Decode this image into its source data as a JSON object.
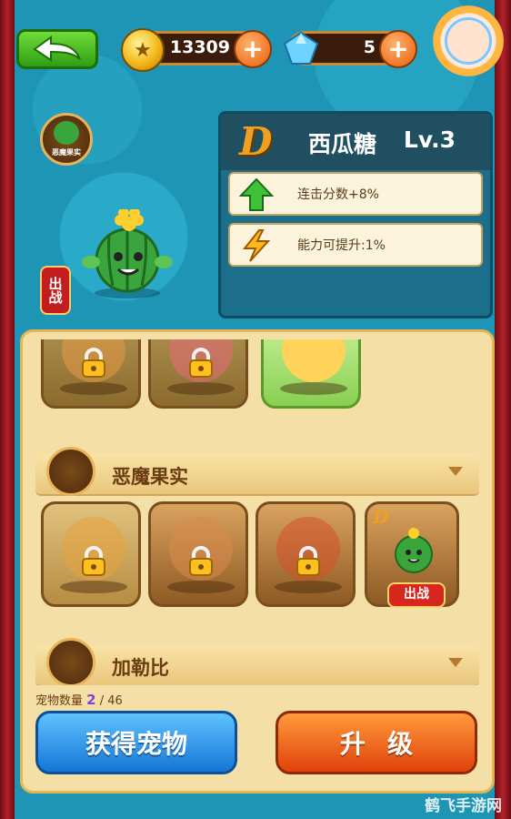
{
  "resources": {
    "coins": "13309",
    "gems": "5"
  },
  "pet": {
    "category_badge": "恶魔果实",
    "battle_tag": "出战",
    "grade": "D",
    "name": "西瓜糖",
    "level": "Lv.3",
    "stats": [
      {
        "text": "连击分数+8%",
        "icon": "green-arrow-up-icon"
      },
      {
        "text": "能力可提升:1%",
        "icon": "lightning-icon"
      }
    ]
  },
  "categories": [
    {
      "name": "恶魔果实",
      "badge": "恶魔果实"
    },
    {
      "name": "加勒比",
      "badge": "加勒比"
    }
  ],
  "slots": {
    "row2_last_grade": "D",
    "row2_last_battle": "出战"
  },
  "footer": {
    "pet_count_label": "宠物数量",
    "pet_count_current": "2",
    "pet_count_total": "/ 46",
    "get_pet_label": "获得宠物",
    "upgrade_label": "升级"
  },
  "watermark": "鹤飞手游网",
  "colors": {
    "accent_green": "#2f9e14",
    "accent_blue": "#1676d6",
    "accent_orange": "#e0420b",
    "panel_bg": "#f4dfa6"
  }
}
